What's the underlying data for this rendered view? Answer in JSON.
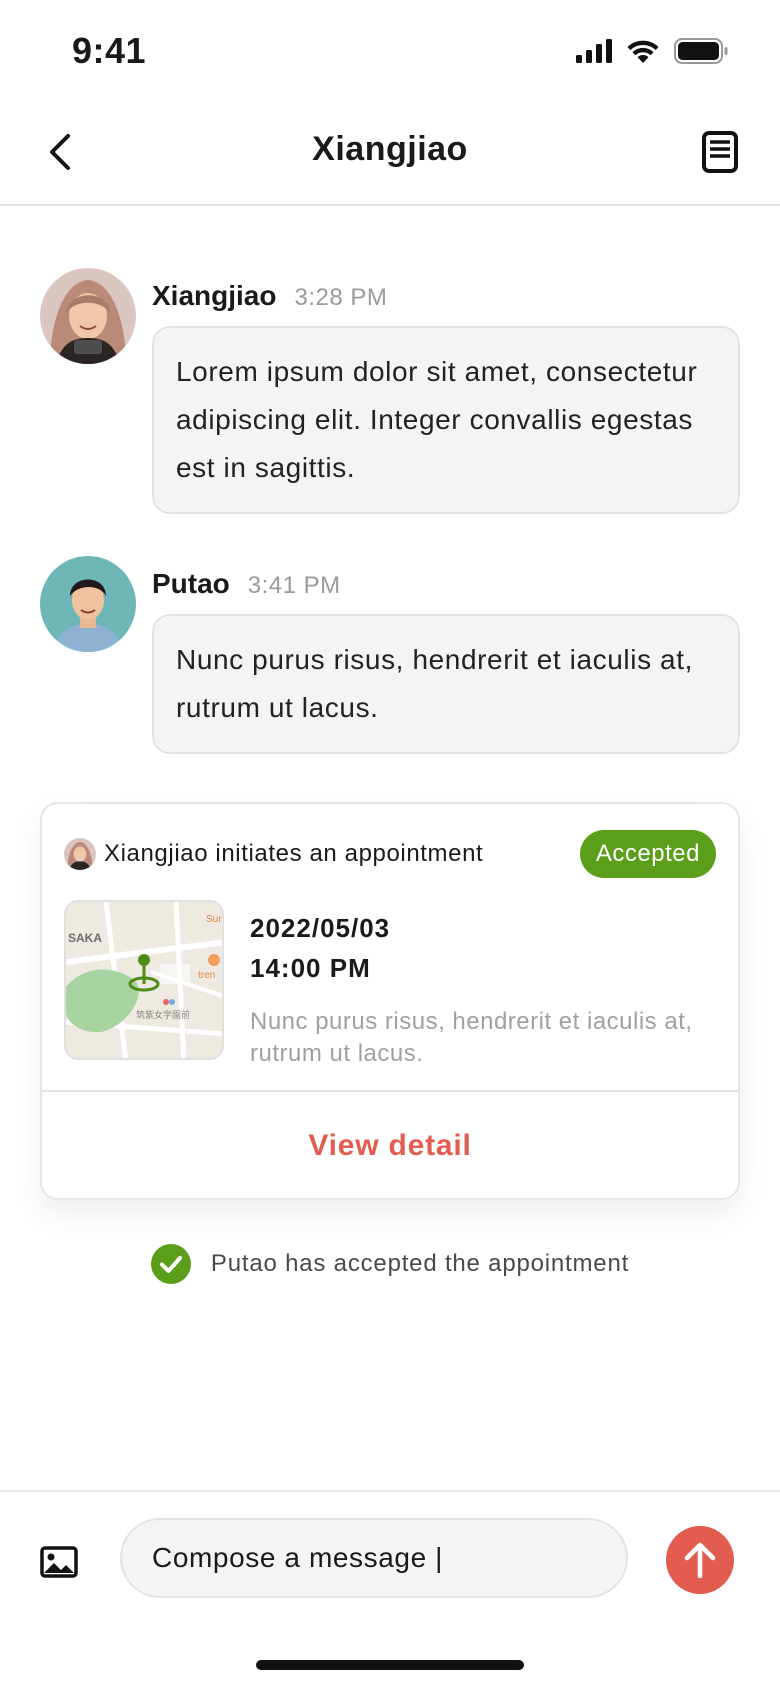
{
  "status_bar": {
    "time": "9:41"
  },
  "header": {
    "title": "Xiangjiao"
  },
  "messages": [
    {
      "name": "Xiangjiao",
      "time": "3:28 PM",
      "text": "Lorem ipsum dolor sit amet, consectetur adipiscing elit. Integer convallis egestas est in sagittis."
    },
    {
      "name": "Putao",
      "time": "3:41 PM",
      "text": "Nunc purus risus, hendrerit et iaculis at, rutrum ut lacus."
    }
  ],
  "appointment": {
    "initiator_text": "Xiangjiao initiates an appointment",
    "status": "Accepted",
    "date": "2022/05/03",
    "time": "14:00 PM",
    "description": "Nunc purus risus, hendrerit et iaculis at, rutrum ut lacus.",
    "view_detail_label": "View detail",
    "map_labels": {
      "left": "SAKA",
      "corner": "Sur",
      "poi": "tren",
      "station": "筑紫女学園前"
    }
  },
  "system_note": "Putao has accepted the appointment",
  "composer": {
    "value": "Compose a message |"
  },
  "colors": {
    "accent": "#e25d50",
    "accepted": "#5b9e19",
    "bubble_bg": "#f4f4f4"
  }
}
